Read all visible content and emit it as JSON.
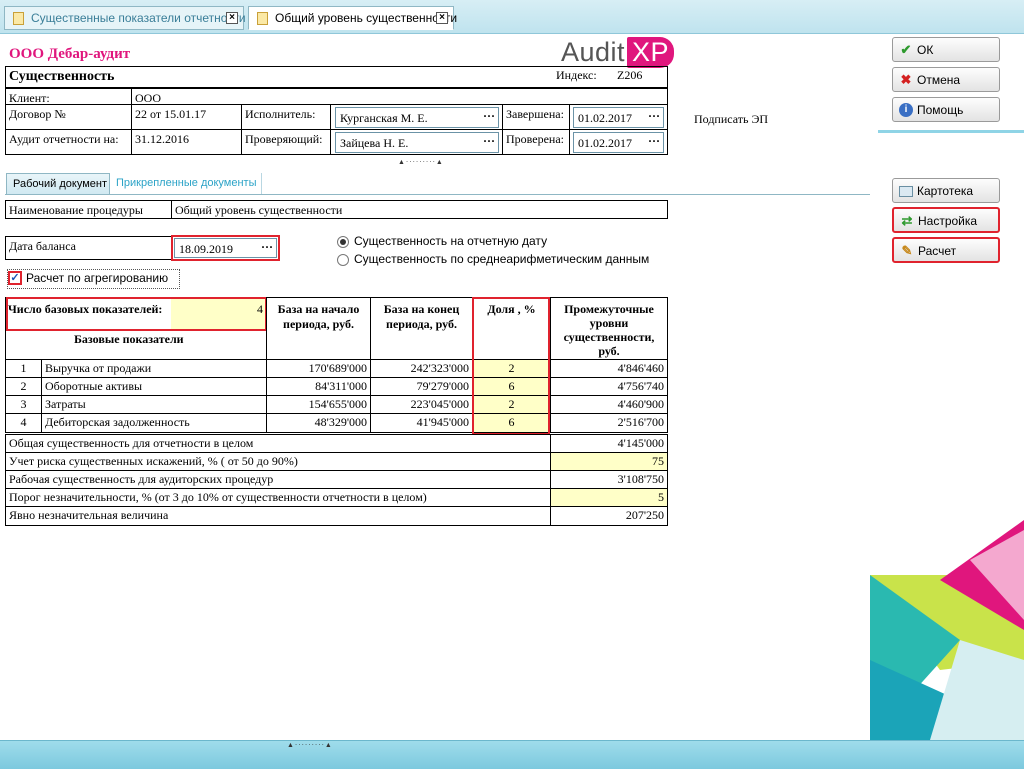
{
  "tabs": [
    {
      "label": "Существенные показатели отчетности",
      "active": false
    },
    {
      "label": "Общий уровень существенности",
      "active": true
    }
  ],
  "header": {
    "company": "ООО Дебар-аудит",
    "logo_text": "Audit",
    "logo_badge": "XP",
    "title": "Существенность",
    "index_label": "Индекс:",
    "index_value": "Z206",
    "client_label": "Клиент:",
    "client_value": "ООО",
    "contract_label": "Договор №",
    "contract_value": "22 от 15.01.17",
    "executor_label": "Исполнитель:",
    "executor_value": "Курганская М. Е.",
    "completed_label": "Завершена:",
    "completed_value": "01.02.2017",
    "audit_label": "Аудит отчетности на:",
    "audit_value": "31.12.2016",
    "reviewer_label": "Проверяющий:",
    "reviewer_value": "Зайцева Н. Е.",
    "checked_label": "Проверена:",
    "checked_value": "01.02.2017",
    "sign_label": "Подписать ЭП"
  },
  "buttons": {
    "ok": "ОК",
    "cancel": "Отмена",
    "help": "Помощь",
    "card": "Картотека",
    "settings": "Настройка",
    "calc": "Расчет"
  },
  "doc_tabs": [
    "Рабочий документ",
    "Прикрепленные документы"
  ],
  "procedure": {
    "label": "Наименование процедуры",
    "value": "Общий уровень существенности"
  },
  "balance_date": {
    "label": "Дата баланса",
    "value": "18.09.2019"
  },
  "radios": [
    {
      "label": "Существенность на отчетную дату",
      "selected": true
    },
    {
      "label": "Существенность по среднеарифметическим данным",
      "selected": false
    }
  ],
  "aggregation": {
    "label": "Расчет по агрегированию",
    "checked": true
  },
  "table": {
    "count_label": "Число базовых показателей:",
    "count_value": "4",
    "base_label": "Базовые показатели",
    "col_start": "База на начало периода, руб.",
    "col_end": "База на конец периода, руб.",
    "col_share": "Доля , %",
    "col_levels": "Промежуточные уровни существенности, руб.",
    "rows": [
      {
        "n": "1",
        "name": "Выручка от продажи",
        "start": "170'689'000",
        "end": "242'323'000",
        "share": "2",
        "level": "4'846'460"
      },
      {
        "n": "2",
        "name": "Оборотные активы",
        "start": "84'311'000",
        "end": "79'279'000",
        "share": "6",
        "level": "4'756'740"
      },
      {
        "n": "3",
        "name": "Затраты",
        "start": "154'655'000",
        "end": "223'045'000",
        "share": "2",
        "level": "4'460'900"
      },
      {
        "n": "4",
        "name": "Дебиторская задолженность",
        "start": "48'329'000",
        "end": "41'945'000",
        "share": "6",
        "level": "2'516'700"
      }
    ],
    "summary": [
      {
        "label": "Общая существенность для отчетности в целом",
        "value": "4'145'000",
        "editable": false
      },
      {
        "label": "Учет риска существенных искажений, % ( от 50 до 90%)",
        "value": "75",
        "editable": true
      },
      {
        "label": "Рабочая существенность для аудиторских процедур",
        "value": "3'108'750",
        "editable": false
      },
      {
        "label": "Порог незначительности, % (от 3 до 10% от существенности отчетности в целом)",
        "value": "5",
        "editable": true
      },
      {
        "label": "Явно незначительная величина",
        "value": "207'250",
        "editable": false
      }
    ]
  },
  "colors": {
    "brand": "#e0167d",
    "highlight": "#e0232e",
    "editable_bg": "#ffffc8",
    "bar": "#8fd4e6"
  }
}
